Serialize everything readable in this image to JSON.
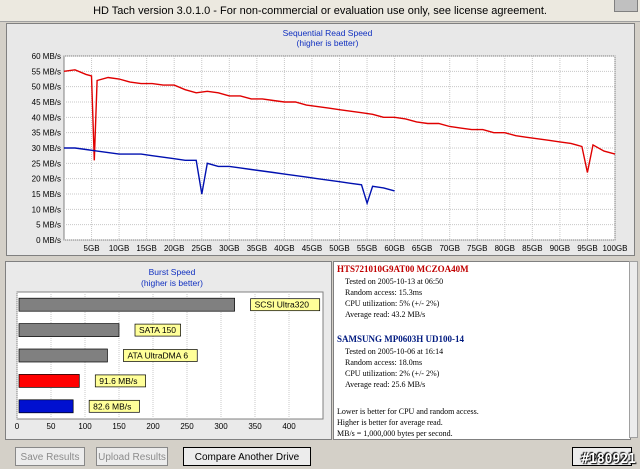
{
  "window": {
    "title": "HD Tach version 3.0.1.0  - For non-commercial or evaluation use only, see license agreement."
  },
  "seq_chart": {
    "title": "Sequential Read Speed",
    "subtitle": "(higher is better)",
    "y_ticks": [
      "60 MB/s",
      "55 MB/s",
      "50 MB/s",
      "45 MB/s",
      "40 MB/s",
      "35 MB/s",
      "30 MB/s",
      "25 MB/s",
      "20 MB/s",
      "15 MB/s",
      "10 MB/s",
      "5 MB/s",
      "0 MB/s"
    ],
    "x_ticks": [
      "5GB",
      "10GB",
      "15GB",
      "20GB",
      "25GB",
      "30GB",
      "35GB",
      "40GB",
      "45GB",
      "50GB",
      "55GB",
      "60GB",
      "65GB",
      "70GB",
      "75GB",
      "80GB",
      "85GB",
      "90GB",
      "95GB",
      "100GB"
    ]
  },
  "chart_data": [
    {
      "type": "line",
      "title": "Sequential Read Speed",
      "subtitle": "(higher is better)",
      "xlabel": "",
      "ylabel": "",
      "ylim": [
        0,
        60
      ],
      "xlim": [
        0,
        100
      ],
      "grid": true,
      "series": [
        {
          "name": "HTS721010G9AT00 MCZOA40M",
          "color": "#e00000",
          "x": [
            0,
            2,
            4,
            5,
            5.5,
            6,
            8,
            10,
            12,
            14,
            16,
            18,
            20,
            22,
            24,
            26,
            28,
            30,
            32,
            34,
            36,
            38,
            40,
            42,
            44,
            46,
            48,
            50,
            52,
            54,
            56,
            58,
            60,
            62,
            64,
            66,
            68,
            70,
            72,
            74,
            76,
            78,
            80,
            82,
            84,
            86,
            88,
            90,
            92,
            93,
            94,
            95,
            96,
            98,
            100
          ],
          "values": [
            55,
            55.5,
            54,
            53.5,
            26,
            52,
            53,
            52.5,
            51.5,
            51,
            51,
            50.5,
            50.5,
            49,
            48,
            48.5,
            48,
            47,
            47,
            46,
            46,
            45.5,
            45,
            45,
            44,
            43.5,
            43,
            42.5,
            42,
            41.5,
            41,
            40,
            40,
            39.5,
            38.5,
            38,
            38,
            37,
            36.5,
            36,
            36,
            35,
            35,
            34,
            33.5,
            33,
            32.5,
            32,
            31.5,
            31,
            30.5,
            22,
            31,
            29,
            28
          ]
        },
        {
          "name": "SAMSUNG MP0603H UD100-14",
          "color": "#0010b0",
          "x": [
            0,
            2,
            4,
            6,
            8,
            10,
            12,
            14,
            16,
            18,
            20,
            22,
            24,
            25,
            26,
            28,
            30,
            32,
            34,
            36,
            38,
            40,
            42,
            44,
            46,
            48,
            50,
            52,
            54,
            55,
            56,
            58,
            60
          ],
          "values": [
            30,
            30,
            29.5,
            29,
            28.5,
            28,
            28,
            28,
            27.5,
            27,
            26.5,
            26,
            26,
            15,
            25,
            24,
            24,
            23.5,
            23,
            22.5,
            22,
            21.5,
            21,
            20.5,
            20,
            19.5,
            19,
            18.5,
            18,
            12,
            17.5,
            17,
            16
          ]
        }
      ]
    },
    {
      "type": "bar",
      "title": "Burst Speed",
      "subtitle": "(higher is better)",
      "xlim": [
        0,
        450
      ],
      "x_ticks": [
        "0",
        "50",
        "100",
        "150",
        "200",
        "250",
        "300",
        "350",
        "400"
      ],
      "categories": [
        "SCSI Ultra320",
        "SATA 150",
        "ATA UltraDMA 6",
        "91.6 MB/s",
        "82.6 MB/s"
      ],
      "values": [
        320,
        150,
        133,
        91.6,
        82.6
      ],
      "colors": [
        "#808080",
        "#808080",
        "#808080",
        "#ff0000",
        "#0010d0"
      ]
    }
  ],
  "drives": [
    {
      "name": "HTS721010G9AT00 MCZOA40M",
      "lines": [
        "Tested on 2005-10-13 at 06:50",
        "Random access: 15.3ms",
        "CPU utilization: 5% (+/- 2%)",
        "Average read: 43.2 MB/s"
      ]
    },
    {
      "name": "SAMSUNG MP0603H UD100-14",
      "lines": [
        "Tested on 2005-10-06 at 16:14",
        "Random access: 18.0ms",
        "CPU utilization: 2% (+/- 2%)",
        "Average read: 25.6 MB/s"
      ]
    }
  ],
  "notes": [
    "Lower is better for CPU and random access.",
    "Higher is better for average read.",
    "MB/s = 1,000,000 bytes per second."
  ],
  "buttons": {
    "save": "Save Results",
    "upload": "Upload Results",
    "compare": "Compare Another Drive",
    "done": "Done"
  },
  "watermark": "#180921"
}
